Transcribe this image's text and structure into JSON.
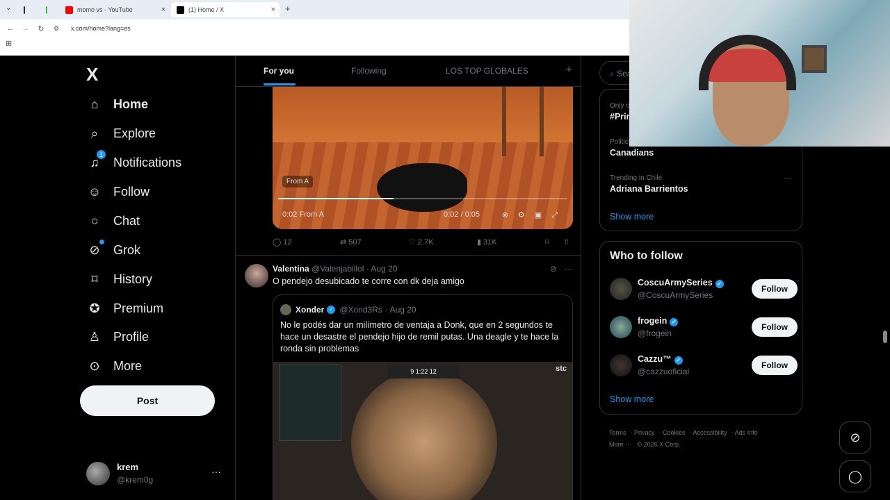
{
  "browser": {
    "tabs": [
      {
        "title": "",
        "favicon_color": "#222"
      },
      {
        "title": "",
        "favicon_color": "#27c93f"
      },
      {
        "title": "momo vs - YouTube",
        "favicon_color": "#ff0000"
      },
      {
        "title": "(1) Home / X",
        "favicon_color": "#000000"
      }
    ],
    "new_tab": "+",
    "url": "x.com/home?lang=es"
  },
  "sidebar": {
    "logo": "X",
    "items": [
      {
        "label": "Home",
        "icon": "home-icon",
        "bold": true
      },
      {
        "label": "Explore",
        "icon": "search-icon"
      },
      {
        "label": "Notifications",
        "icon": "bell-icon",
        "badge": "1"
      },
      {
        "label": "Follow",
        "icon": "person-add-icon"
      },
      {
        "label": "Chat",
        "icon": "chat-icon"
      },
      {
        "label": "Grok",
        "icon": "grok-icon"
      },
      {
        "label": "History",
        "icon": "bookmark-icon"
      },
      {
        "label": "Premium",
        "icon": "premium-icon"
      },
      {
        "label": "Profile",
        "icon": "person-icon"
      },
      {
        "label": "More",
        "icon": "more-icon"
      }
    ],
    "post_button": "Post",
    "user": {
      "name": "krem",
      "handle": "@krem0g"
    }
  },
  "feed": {
    "tabs": [
      "For you",
      "Following",
      "LOS TOP GLOBALES"
    ],
    "video": {
      "from_badge": "From  A",
      "time": "0:02 / 0:05",
      "progress": 0.4,
      "mini_label": "0:02  From  A"
    },
    "actions": {
      "replies": "12",
      "reposts": "507",
      "likes": "2.7K",
      "views": "31K"
    },
    "tweet": {
      "name": "Valentina",
      "handle": "@Valenjabillol",
      "date": "· Aug 20",
      "text": "O pendejo desubicado te corre con dk deja amigo",
      "quote": {
        "name": "Xonder",
        "handle": "@Xond3Rs",
        "date": "· Aug 20",
        "text": "No le podés dar un milímetro de ventaja a Donk, que en 2 segundos te hace un desastre el pendejo hijo de remil putas. Una deagle y te hace la ronda sin problemas",
        "hud_score": "9  1:22  12",
        "hud_brand": "stc"
      }
    }
  },
  "right": {
    "search_placeholder": "Search",
    "trends": [
      {
        "context": "Only on X · Trending",
        "title": "#Prim"
      },
      {
        "context": "Politics · Trending",
        "title": "Canadians"
      },
      {
        "context": "Trending in Chile",
        "title": "Adriana Barrientos"
      }
    ],
    "show_more": "Show more",
    "who_to_follow": {
      "title": "Who to follow",
      "accounts": [
        {
          "name": "CoscuArmySeries",
          "handle": "@CoscuArmySeries"
        },
        {
          "name": "frogein",
          "handle": "@frogein"
        },
        {
          "name": "Cazzu™",
          "handle": "@cazzuoficial"
        }
      ],
      "follow_label": "Follow",
      "show_more": "Show more"
    },
    "footer": [
      "Terms",
      "Privacy",
      "Cookies",
      "Accessibility",
      "Ads Info",
      "More ···",
      "© 2026 X Corp."
    ]
  },
  "colors": {
    "accent": "#1d9bf0",
    "background": "#000000",
    "text": "#e7e9ea",
    "muted": "#71767b"
  }
}
